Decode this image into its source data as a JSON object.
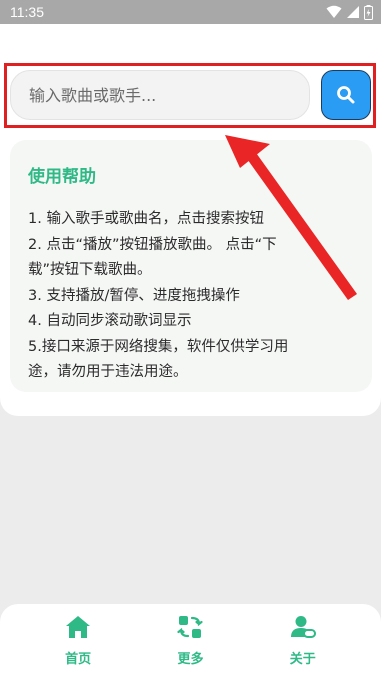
{
  "status_bar": {
    "time": "11:35"
  },
  "search": {
    "placeholder": "输入歌曲或歌手..."
  },
  "help": {
    "title": "使用帮助",
    "lines": [
      "1. 输入歌手或歌曲名，点击搜索按钮",
      "2. 点击“播放”按钮播放歌曲。 点击“下",
      "载”按钮下载歌曲。",
      "3. 支持播放/暂停、进度拖拽操作",
      "4. 自动同步滚动歌词显示",
      "5.接口来源于网络搜集，软件仅供学习用",
      "途，请勿用于违法用途。"
    ]
  },
  "bottom_nav": {
    "items": [
      {
        "label": "首页",
        "icon": "home-icon"
      },
      {
        "label": "更多",
        "icon": "swap-icon"
      },
      {
        "label": "关于",
        "icon": "user-icon"
      }
    ]
  },
  "colors": {
    "accent": "#2fb987",
    "search_button": "#2b9cf3",
    "highlight": "#e02020"
  }
}
